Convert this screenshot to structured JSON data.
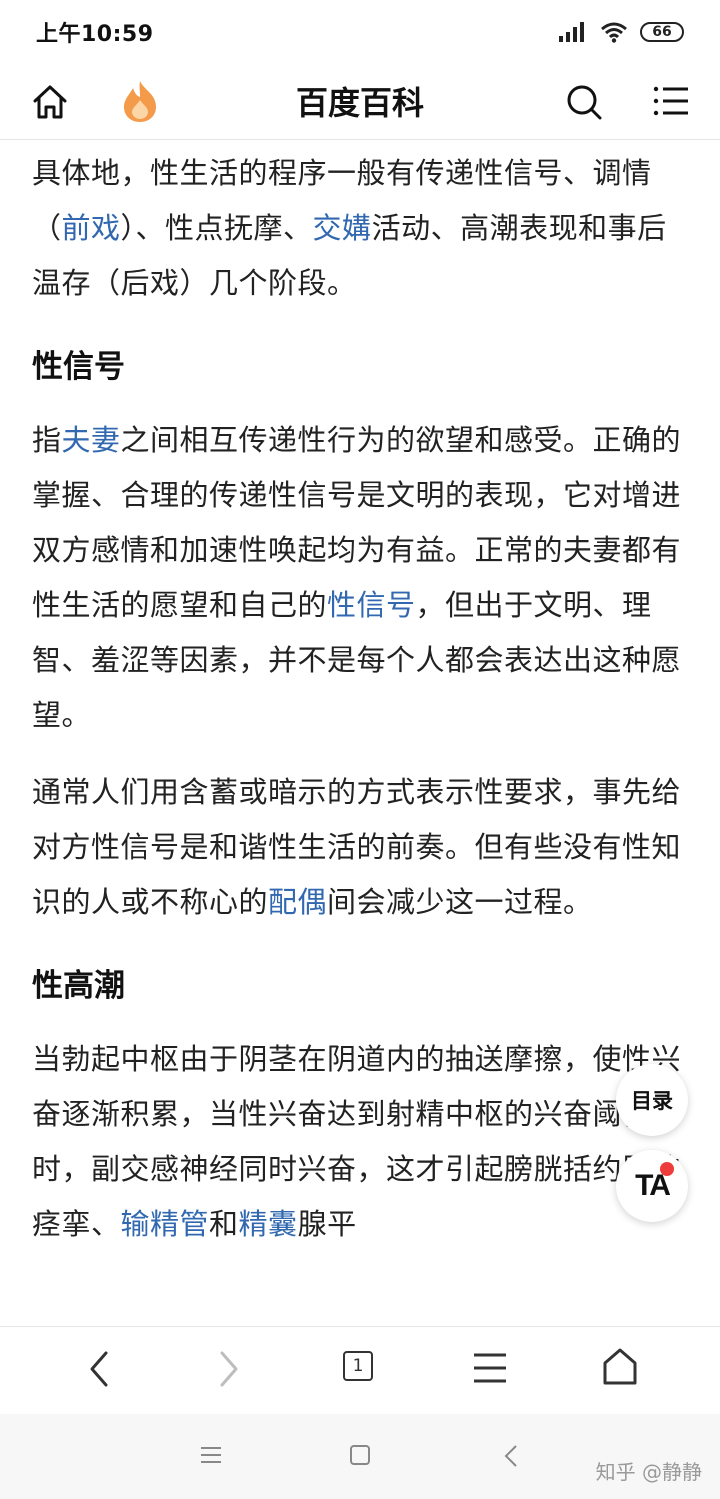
{
  "status_bar": {
    "time": "上午10:59",
    "battery": "66"
  },
  "header": {
    "title": "百度百科"
  },
  "article": {
    "p1": {
      "t1": "具体地，性生活的程序一般有传递性信号、调情（",
      "l1": "前戏",
      "t2": "）、性点抚摩、",
      "l2": "交媾",
      "t3": "活动、高潮表现和事后温存（后戏）几个阶段。"
    },
    "h1": "性信号",
    "p2": {
      "t1": "指",
      "l1": "夫妻",
      "t2": "之间相互传递性行为的欲望和感受。正确的掌握、合理的传递性信号是文明的表现，它对增进双方感情和加速性唤起均为有益。正常的夫妻都有性生活的愿望和自己的",
      "l2": "性信号",
      "t3": "，但出于文明、理智、羞涩等因素，并不是每个人都会表达出这种愿望。"
    },
    "p3": {
      "t1": "通常人们用含蓄或暗示的方式表示性要求，事先给对方性信号是和谐性生活的前奏。但有些没有性知识的人或不称心的",
      "l1": "配偶",
      "t2": "间会减少这一过程。"
    },
    "h2": "性高潮",
    "p4": {
      "t1": "当勃起中枢由于阴茎在阴道内的抽送摩擦，使性兴奋逐渐积累，当性兴奋达到射精中枢的兴奋阈值时，副交感神经同时兴奋，这才引起膀胱括约肌的痉挛、",
      "l1": "输精管",
      "t2": "和",
      "l2": "精囊",
      "t3": "腺平"
    }
  },
  "floating": {
    "toc_label": "目录",
    "ta_label": "TA"
  },
  "toolbar": {
    "tab_count": "1"
  },
  "watermark": "知乎 @静静",
  "colors": {
    "link": "#3168b0",
    "text": "#222222",
    "accent_flame": "#f39a4b"
  }
}
